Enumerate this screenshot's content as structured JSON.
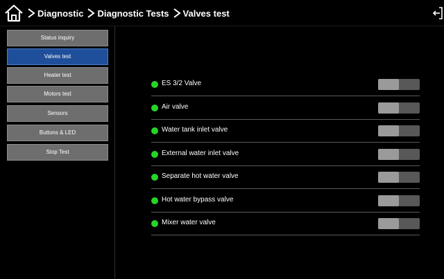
{
  "header": {
    "breadcrumbs": [
      "Diagnostic",
      "Diagnostic Tests",
      "Valves test"
    ],
    "home_icon": "home-icon",
    "exit_icon": "exit-icon"
  },
  "sidebar": {
    "items": [
      {
        "label": "Status inquiry",
        "active": false
      },
      {
        "label": "Valves test",
        "active": true
      },
      {
        "label": "Heater test",
        "active": false
      },
      {
        "label": "Motors test",
        "active": false
      },
      {
        "label": "Sensors",
        "active": false
      },
      {
        "label": "Buttons & LED",
        "active": false
      },
      {
        "label": "Stop Test",
        "active": false
      }
    ]
  },
  "valves": [
    {
      "label": "ES 3/2 Valve",
      "status": "ok",
      "on": false
    },
    {
      "label": "Air valve",
      "status": "ok",
      "on": false
    },
    {
      "label": "Water tank inlet valve",
      "status": "ok",
      "on": false
    },
    {
      "label": "External water inlet valve",
      "status": "ok",
      "on": false
    },
    {
      "label": "Separate hot water valve",
      "status": "ok",
      "on": false
    },
    {
      "label": "Hot water bypass valve",
      "status": "ok",
      "on": false
    },
    {
      "label": "Mixer water valve",
      "status": "ok",
      "on": false
    }
  ],
  "colors": {
    "background": "#000000",
    "active_button": "#1f4f9a",
    "button": "#6e6e6e",
    "status_ok": "#27d427"
  }
}
